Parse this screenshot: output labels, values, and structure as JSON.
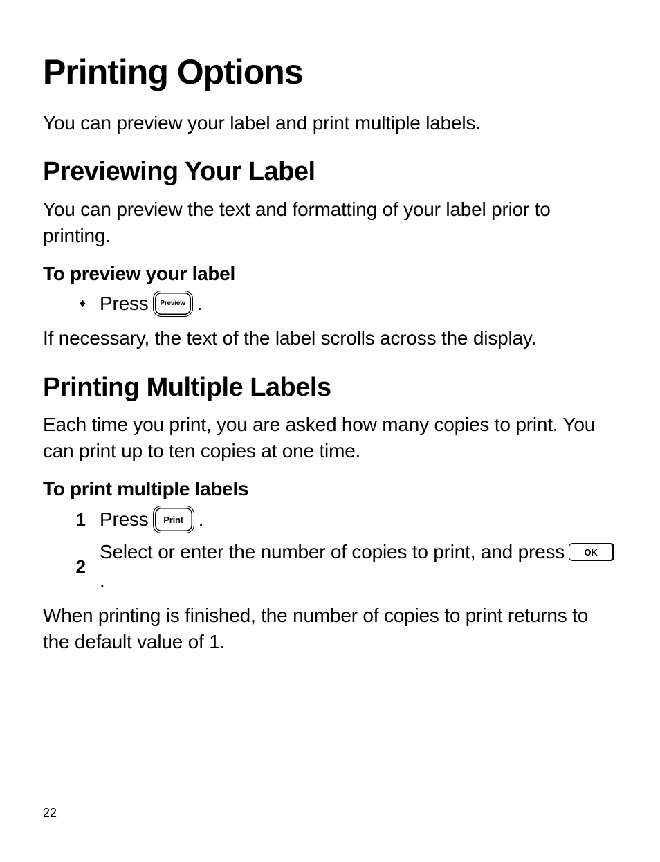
{
  "title": "Printing Options",
  "intro": "You can preview your label and print multiple labels.",
  "section1": {
    "heading": "Previewing Your Label",
    "para": "You can preview the text and formatting of your label prior to printing.",
    "task_heading": "To preview your label",
    "bullet_marker": "♦",
    "step1_pre": "Press",
    "step1_key": "Preview",
    "step1_post": ".",
    "after": "If necessary, the text of the label scrolls across the display."
  },
  "section2": {
    "heading": "Printing Multiple Labels",
    "para": "Each time you print, you are asked how many copies to print. You can print up to ten copies at one time.",
    "task_heading": "To print multiple labels",
    "step1_marker": "1",
    "step1_pre": "Press",
    "step1_key": "Print",
    "step1_post": ".",
    "step2_marker": "2",
    "step2_pre": "Select or enter the number of copies to print, and press",
    "step2_key": "OK",
    "step2_post": ".",
    "after": "When printing is finished, the number of copies to print returns to the default value of 1."
  },
  "page_number": "22"
}
